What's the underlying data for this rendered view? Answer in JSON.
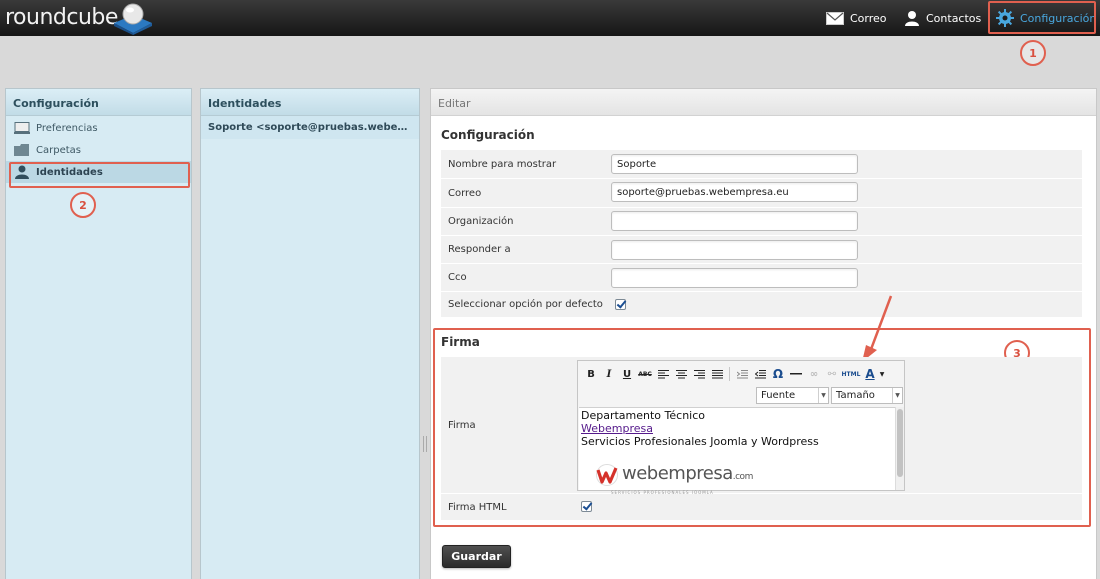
{
  "app": {
    "logo_text": "roundcube"
  },
  "nav": {
    "correo": "Correo",
    "contactos": "Contactos",
    "configuracion": "Configuración"
  },
  "markers": {
    "m1": "1",
    "m2": "2",
    "m3": "3"
  },
  "settings": {
    "title": "Configuración",
    "items": [
      {
        "label": "Preferencias",
        "icon": "monitor-icon"
      },
      {
        "label": "Carpetas",
        "icon": "folder-icon"
      },
      {
        "label": "Identidades",
        "icon": "person-icon",
        "selected": true
      }
    ]
  },
  "identities": {
    "title": "Identidades",
    "list": [
      "Soporte <soporte@pruebas.webempresa.eu>"
    ]
  },
  "edit": {
    "title": "Editar",
    "section_config": "Configuración",
    "fields": {
      "display_name": {
        "label": "Nombre para mostrar",
        "value": "Soporte"
      },
      "email": {
        "label": "Correo",
        "value": "soporte@pruebas.webempresa.eu"
      },
      "organization": {
        "label": "Organización",
        "value": ""
      },
      "reply_to": {
        "label": "Responder a",
        "value": ""
      },
      "bcc": {
        "label": "Cco",
        "value": ""
      },
      "default": {
        "label": "Seleccionar opción por defecto",
        "checked": true
      }
    },
    "section_signature": "Firma",
    "signature": {
      "label": "Firma",
      "font_select": "Fuente",
      "size_select": "Tamaño",
      "toolbar_html": "HTML",
      "lines": [
        "Departamento Técnico",
        "Webempresa",
        "Servicios Profesionales Joomla y Wordpress"
      ],
      "logo_main": "webempresa",
      "logo_suffix": ".com",
      "logo_tagline": "SERVICIOS PROFESIONALES JOOMLA"
    },
    "html_signature": {
      "label": "Firma HTML",
      "checked": true
    },
    "save_button": "Guardar"
  },
  "colors": {
    "accent": "#49a7de",
    "highlight": "#e0604f",
    "panel_blue": "#d7ebf3"
  }
}
